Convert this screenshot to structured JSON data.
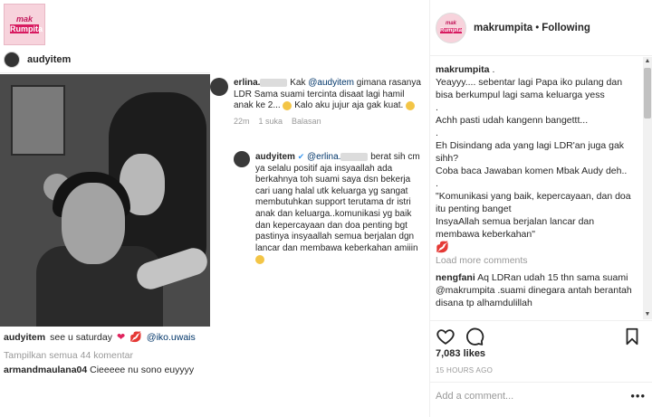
{
  "left_post": {
    "logo": {
      "line1": "mak",
      "line2": "Rumpita"
    },
    "username": "audyitem",
    "caption": {
      "user": "audyitem",
      "text": "see u saturday",
      "mention": "@iko.uwais"
    },
    "view_all": "Tampilkan semua 44 komentar",
    "comment": {
      "user": "armandmaulana04",
      "text": "Cieeeee nu sono euyyyy"
    }
  },
  "middle_comments": {
    "first": {
      "user": "erlina.",
      "text_pre": "Kak",
      "mention": "@audyitem",
      "text": "gimana rasanya LDR Sama suami tercinta disaat lagi hamil anak ke 2...",
      "text_post": "Kalo aku jujur aja gak kuat.",
      "time": "22m",
      "likes": "1 suka",
      "reply": "Balasan"
    },
    "reply": {
      "user": "audyitem",
      "mention": "@erlina.",
      "text": "berat sih cm ya selalu positif aja insyaallah ada berkahnya toh suami saya dsn bekerja cari uang halal utk keluarga yg sangat membutuhkan support terutama dr istri anak dan keluarga..komunikasi yg baik dan kepercayaan dan doa penting bgt pastinya insyaallah semua berjalan dgn lancar dan membawa keberkahan amiiin"
    }
  },
  "right_panel": {
    "logo": {
      "line1": "mak",
      "line2": "Rumpita"
    },
    "username": "makrumpita",
    "separator": "•",
    "follow_status": "Following",
    "caption_user": "makrumpita",
    "caption_user_suffix": ".",
    "caption_lines": [
      "Yeayyy.... sebentar lagi Papa iko pulang dan bisa berkumpul lagi sama keluarga yess",
      ".",
      "Achh pasti udah kangenn bangettt...",
      ".",
      "Eh Disindang ada yang lagi LDR'an juga gak sihh?",
      "Coba baca Jawaban komen Mbak Audy deh..",
      ".",
      "\"Komunikasi yang baik, kepercayaan, dan doa itu penting banget",
      "InsyaAllah semua berjalan lancar dan membawa keberkahan\""
    ],
    "load_more": "Load more comments",
    "comment": {
      "user": "nengfani",
      "text": "Aq LDRan udah 15 thn sama suami @makrumpita .suami dinegara antah berantah disana tp alhamdulillah"
    },
    "likes": "7,083 likes",
    "time_ago": "15 HOURS AGO",
    "add_comment_placeholder": "Add a comment...",
    "more": "•••"
  }
}
